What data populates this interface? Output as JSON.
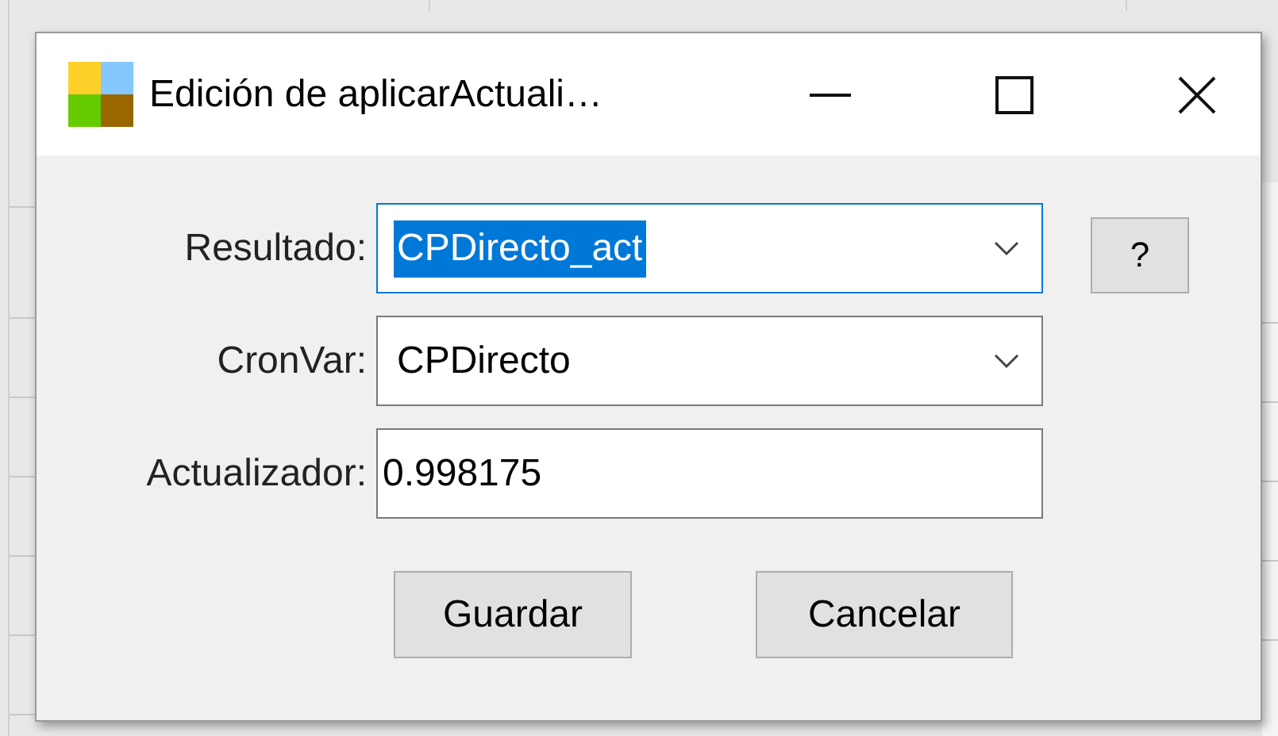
{
  "window": {
    "title": "Edición de aplicarActuali…"
  },
  "fields": [
    {
      "kind": "combo",
      "label": "Resultado:",
      "value": "CPDirecto_act",
      "focused": true,
      "text_selected": true
    },
    {
      "kind": "combo",
      "label": "CronVar:",
      "value": "CPDirecto",
      "focused": false,
      "text_selected": false
    },
    {
      "kind": "text",
      "label": "Actualizador:",
      "value": "0.998175",
      "focused": false,
      "text_selected": false
    }
  ],
  "help_button": "?",
  "buttons": [
    "Guardar",
    "Cancelar"
  ]
}
